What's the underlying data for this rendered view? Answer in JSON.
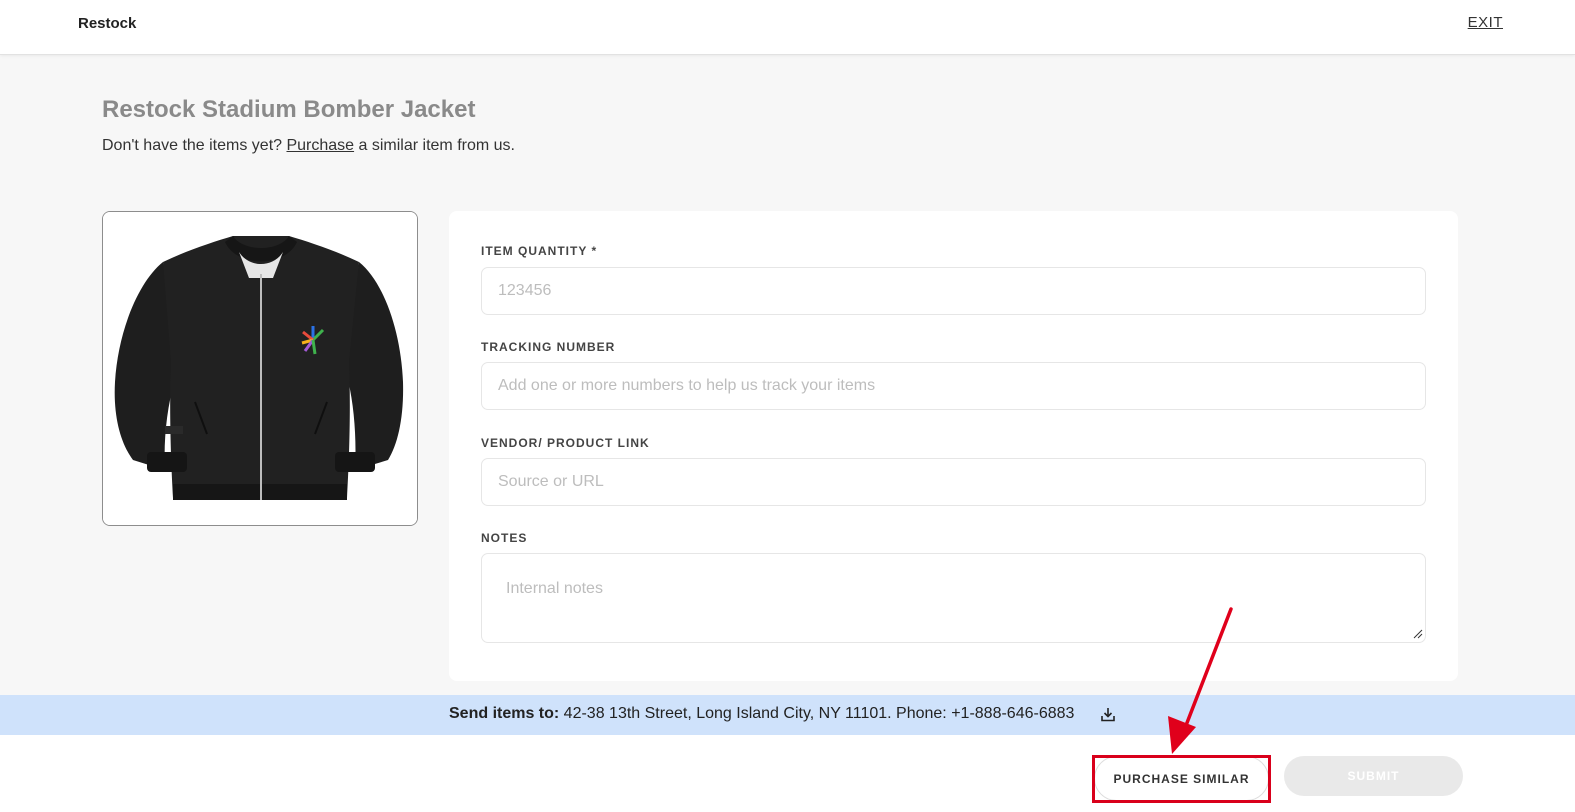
{
  "header": {
    "brand": "Restock",
    "exit_label": "EXIT"
  },
  "page": {
    "title": "Restock Stadium Bomber Jacket",
    "subtitle_before": "Don't have the items yet? ",
    "subtitle_link": "Purchase",
    "subtitle_after": " a similar item from us."
  },
  "product": {
    "image_alt": "Black bomber jacket"
  },
  "form": {
    "quantity": {
      "label": "ITEM QUANTITY *",
      "placeholder": "123456"
    },
    "tracking": {
      "label": "TRACKING NUMBER",
      "placeholder": "Add one or more numbers to help us track your items"
    },
    "vendor": {
      "label": "VENDOR/ PRODUCT LINK",
      "placeholder": "Source or URL"
    },
    "notes": {
      "label": "NOTES",
      "placeholder": "Internal notes"
    }
  },
  "shipping": {
    "label": "Send items to:",
    "address": " 42-38 13th Street, Long Island City, NY 11101. Phone: +1-888-646-6883"
  },
  "footer": {
    "purchase_label": "PURCHASE SIMILAR",
    "submit_label": "SUBMIT"
  },
  "annotation": {
    "highlight_color": "#d9001b"
  },
  "colors": {
    "ship_bar": "#cfe2fb",
    "title_gray": "#8a8a8a"
  }
}
